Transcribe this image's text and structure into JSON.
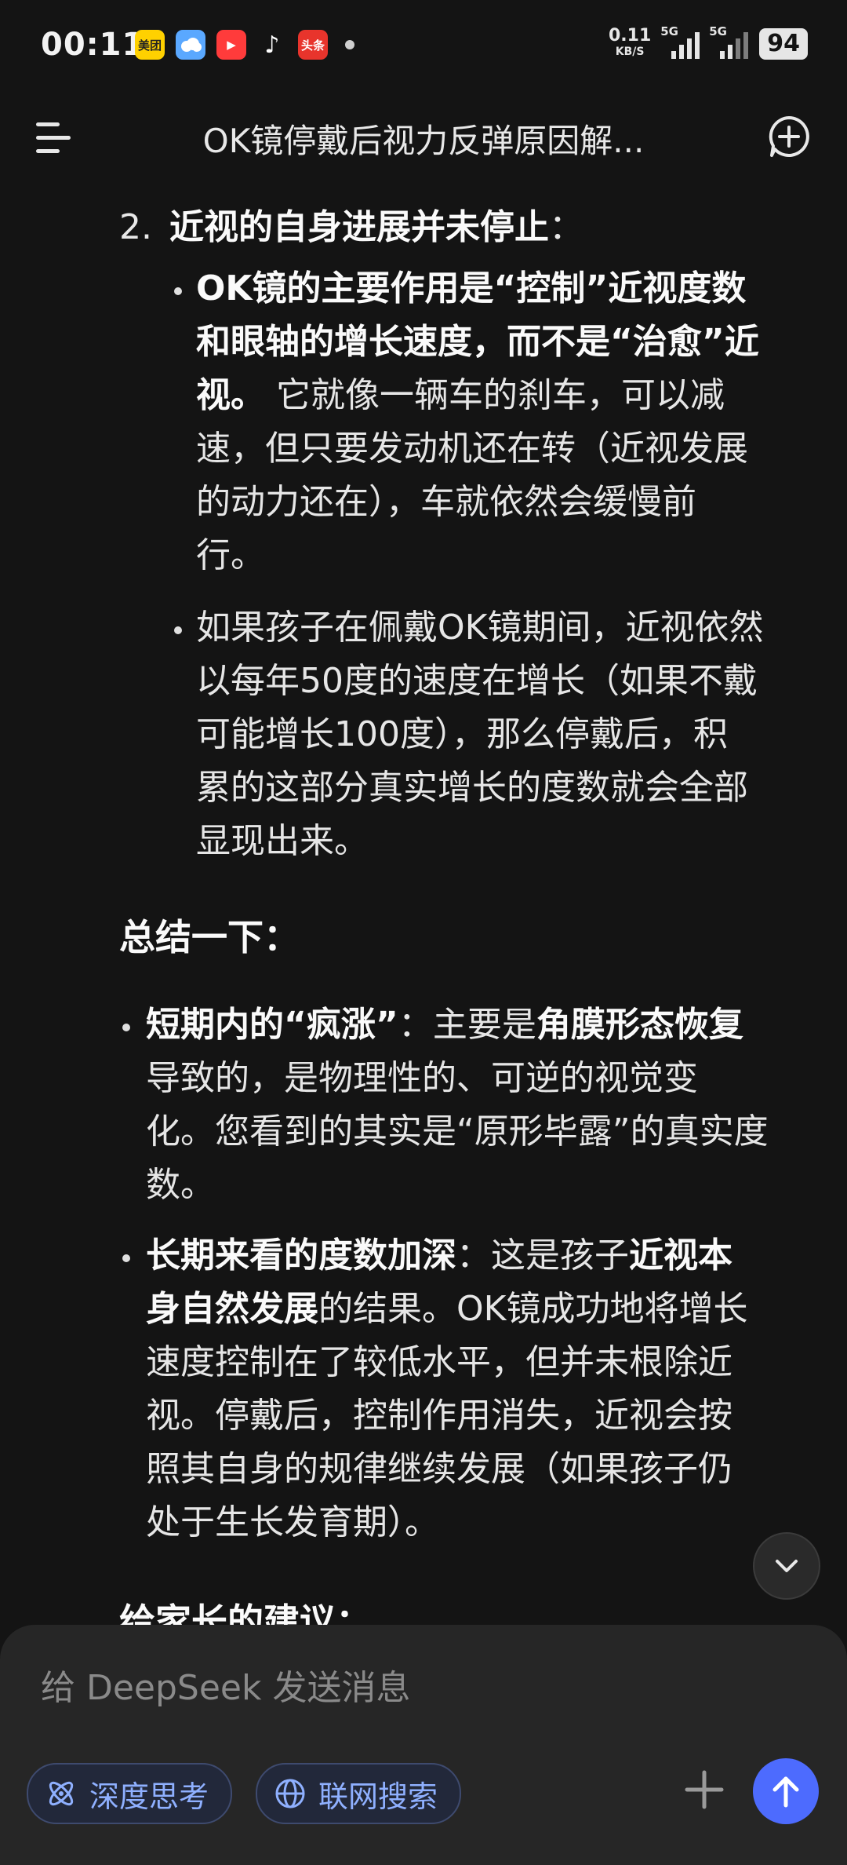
{
  "status_bar": {
    "time": "00:11",
    "apps": [
      {
        "name": "meituan-icon",
        "label": "美团",
        "color": "#ffd100"
      },
      {
        "name": "weather-icon",
        "label": "",
        "color": "#5aa8ff"
      },
      {
        "name": "video-icon",
        "label": "▶",
        "color": "#ff3b3b"
      },
      {
        "name": "tiktok-icon",
        "label": "♪",
        "color": "#141414"
      },
      {
        "name": "toutiao-icon",
        "label": "头条",
        "color": "#e8342c"
      }
    ],
    "net_speed": "0.11",
    "net_unit": "KB/S",
    "signal1": "5G",
    "signal2": "5G",
    "battery": "94"
  },
  "header": {
    "title": "OK镜停戴后视力反弹原因解..."
  },
  "content": {
    "item2_num": "2.",
    "item2_title": "近视的自身进展并未停止",
    "colon": "：",
    "sub1_bold_1": "OK镜的主要作用是“控制”近视度数",
    "sub1_bold_2": "和眼轴的增长速度，而不是“治愈”近",
    "sub1_bold_3": "视。",
    "sub1_text_3": " 它就像一辆车的刹车，可以减",
    "sub1_text_4": "速，但只要发动机还在转（近视发展",
    "sub1_text_5": "的动力还在），车就依然会缓慢前",
    "sub1_text_6": "行。",
    "sub2_1": "如果孩子在佩戴OK镜期间，近视依然",
    "sub2_2": "以每年50度的速度在增长（如果不戴",
    "sub2_3": "可能增长100度），那么停戴后，积",
    "sub2_4": "累的这部分真实增长的度数就会全部",
    "sub2_5": "显现出来。",
    "summary_heading": "总结一下：",
    "s1_bold": "短期内的“疯涨”",
    "s1_mid": "：主要是",
    "s1_bold2": "角膜形态恢复",
    "s1_2": "导致的，是物理性的、可逆的视觉变",
    "s1_3": "化。您看到的其实是“原形毕露”的真实度",
    "s1_4": "数。",
    "s2_bold": "长期来看的度数加深",
    "s2_mid": "：这是孩子",
    "s2_bold2": "近视本",
    "s2_bold3": "身自然发展",
    "s2_2": "的结果。OK镜成功地将增长",
    "s2_3": "速度控制在了较低水平，但并未根除近",
    "s2_4": "视。停戴后，控制作用消失，近视会按",
    "s2_5": "照其自身的规律继续发展（如果孩子仍",
    "s2_6": "处于生长发育期）。",
    "advice_heading": "给家长的建议："
  },
  "composer": {
    "placeholder": "给 DeepSeek 发送消息",
    "deep_think": "深度思考",
    "web_search": "联网搜索"
  }
}
